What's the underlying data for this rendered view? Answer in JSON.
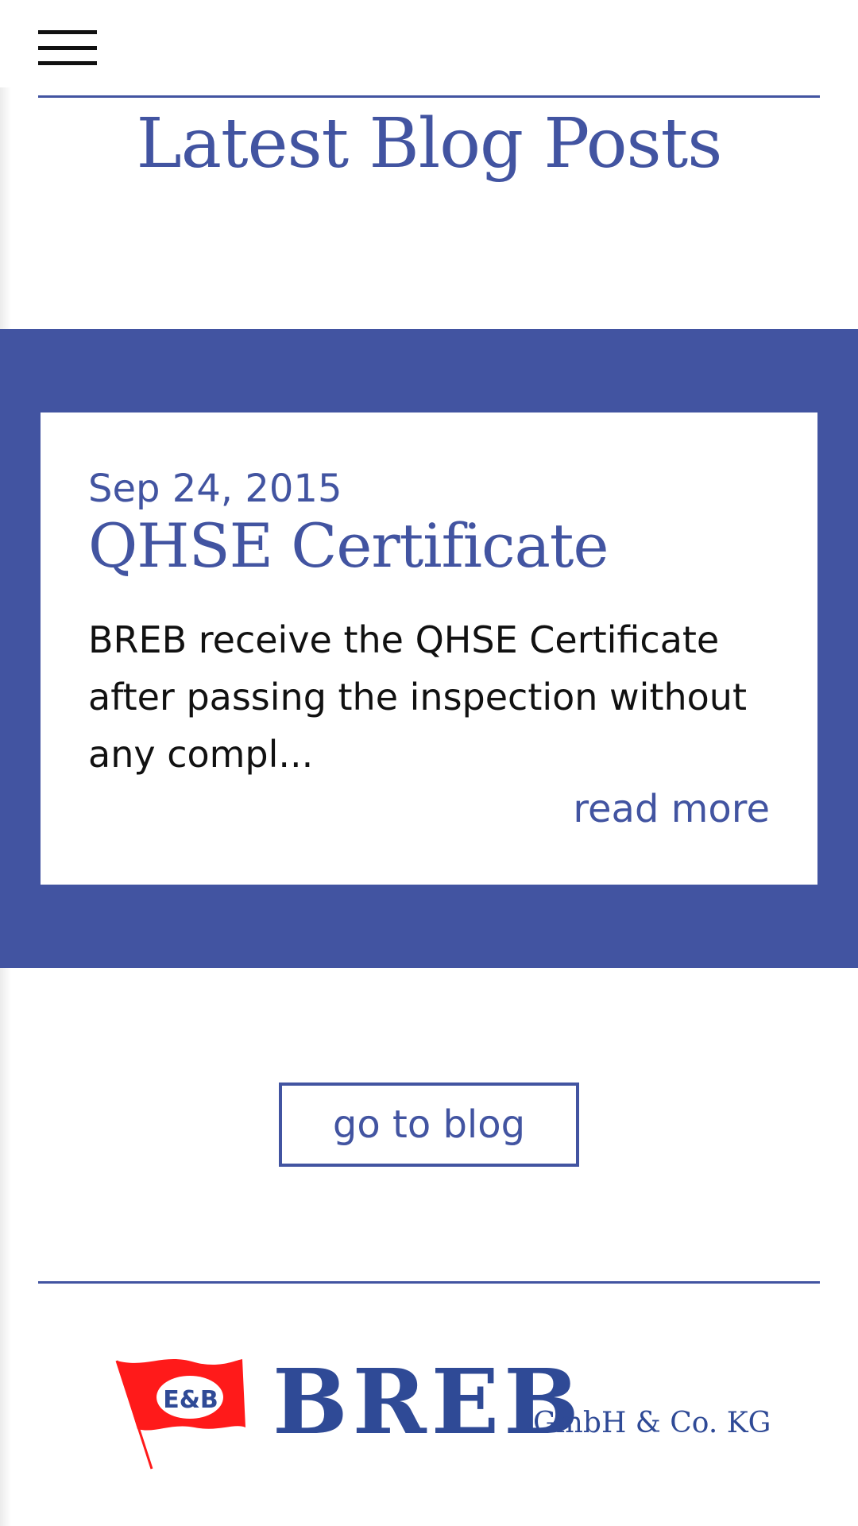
{
  "header": {
    "menu_icon": "hamburger-menu-icon"
  },
  "blog_section": {
    "title": "Latest Blog Posts",
    "posts": [
      {
        "date": "Sep 24, 2015",
        "title": "QHSE Certificate",
        "excerpt": "BREB receive the QHSE Certificate after passing the inspection without any compl...",
        "read_more_label": "read more"
      }
    ],
    "go_to_blog_label": "go to blog"
  },
  "footer": {
    "logo_icon": "e-and-b-flag-logo-icon",
    "logo_flag_text": "E&B",
    "brand_name": "BREB",
    "brand_suffix": "GmbH & Co. KG"
  },
  "colors": {
    "accent": "#4254a1",
    "brand": "#2f4a96",
    "flag_red": "#ff1a1a",
    "text": "#111111",
    "background": "#ffffff"
  }
}
